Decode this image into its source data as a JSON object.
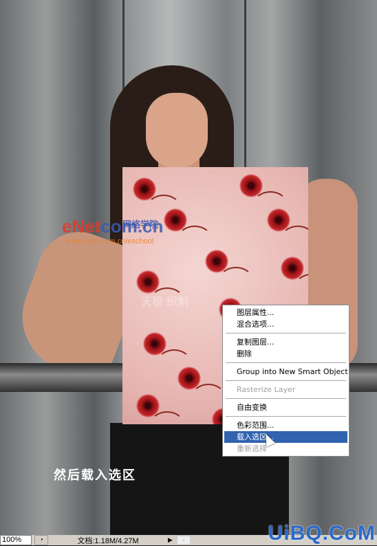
{
  "image": {
    "watermark_brand": "eNet",
    "watermark_domain": "com.cn",
    "watermark_cn": "网络学院",
    "watermark_url": "www.enet.com.cn/eschool",
    "watermark_faint": "天极 织制",
    "caption": "然后载入选区"
  },
  "context_menu": {
    "items": [
      {
        "label": "图层属性...",
        "state": "normal"
      },
      {
        "label": "混合选项...",
        "state": "normal"
      },
      {
        "label": "复制图层...",
        "state": "normal"
      },
      {
        "label": "删除",
        "state": "normal"
      },
      {
        "label": "Group into New Smart Object",
        "state": "normal"
      },
      {
        "label": "Rasterize Layer",
        "state": "disabled"
      },
      {
        "label": "自由变换",
        "state": "normal"
      },
      {
        "label": "色彩范围...",
        "state": "normal"
      },
      {
        "label": "载入选区...",
        "state": "highlighted"
      },
      {
        "label": "重新选择",
        "state": "disabled"
      }
    ],
    "highlight_color": "#3163b0"
  },
  "status_bar": {
    "zoom": "100%",
    "doc_info": "文档:1.18M/4.27M"
  },
  "site_logo": "UiBQ.CoM"
}
